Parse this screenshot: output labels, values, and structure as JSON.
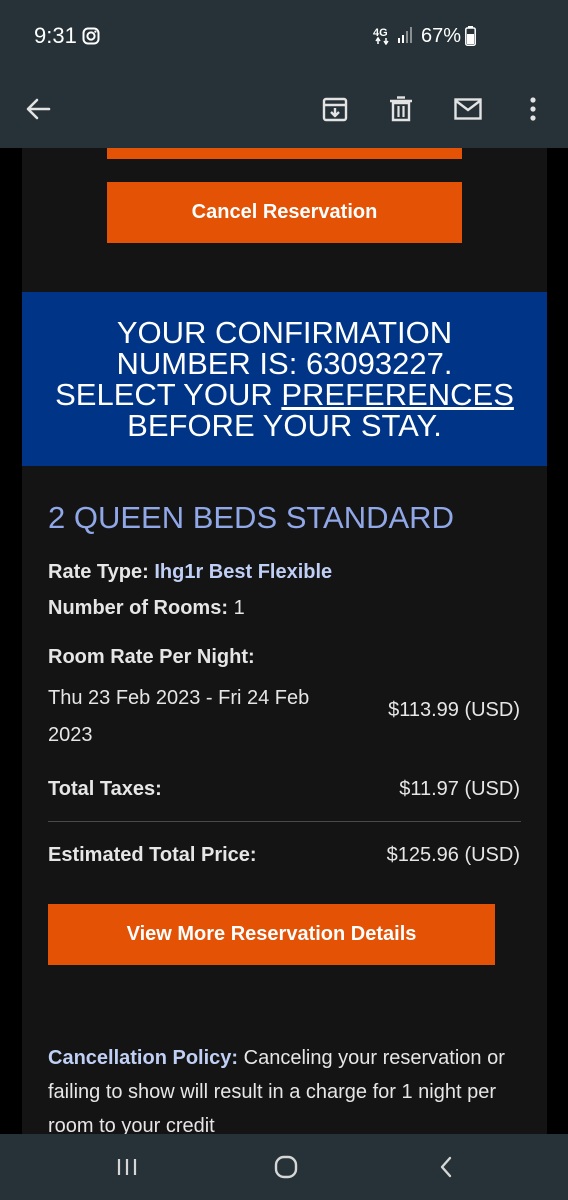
{
  "status_bar": {
    "time": "9:31",
    "network": "4G",
    "battery_percent": "67%"
  },
  "app_bar": {
    "icons": [
      "back-arrow-icon",
      "archive-icon",
      "delete-icon",
      "mark-unread-icon",
      "more-options-icon"
    ]
  },
  "email": {
    "cancel_button": "Cancel Reservation",
    "confirmation": {
      "line1": "YOUR CONFIRMATION",
      "line2": "NUMBER IS: 63093227.",
      "line3_prefix": "SELECT YOUR ",
      "line3_link": "PREFERENCES",
      "line4": "BEFORE YOUR STAY."
    },
    "room_type": "2 QUEEN BEDS STANDARD",
    "rate_type_label": "Rate Type:",
    "rate_type_value": "Ihg1r Best Flexible",
    "rooms_label": "Number of Rooms:",
    "rooms_value": "1",
    "room_rate_label": "Room Rate Per Night:",
    "date_range": "Thu 23 Feb 2023 - Fri 24 Feb 2023",
    "room_rate_price": "$113.99 (USD)",
    "taxes_label": "Total Taxes:",
    "taxes_price": "$11.97 (USD)",
    "total_label": "Estimated Total Price:",
    "total_price": "$125.96 (USD)",
    "view_more_button": "View More Reservation Details",
    "policy_label": "Cancellation Policy:",
    "policy_text": "Canceling your reservation or failing to show will result in a charge for 1 night per room to your credit"
  },
  "colors": {
    "accent_orange": "#e35205",
    "banner_blue": "#003486",
    "room_title_blue": "#90a7e8",
    "bar_background": "#263238"
  }
}
